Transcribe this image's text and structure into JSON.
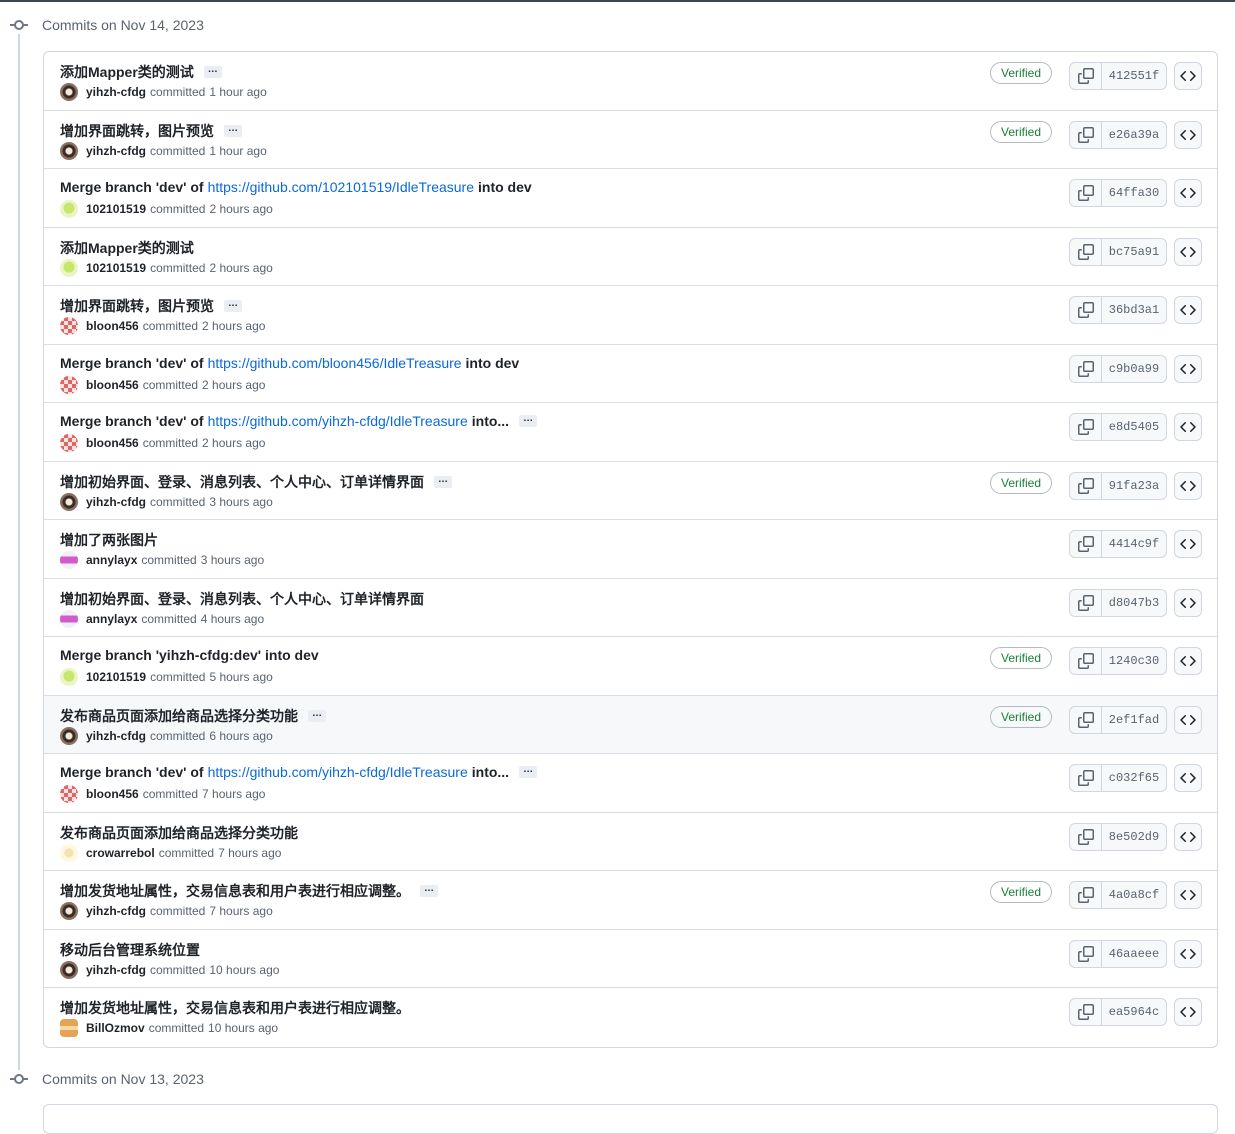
{
  "groups": [
    {
      "title": "Commits on Nov 14, 2023"
    },
    {
      "title": "Commits on Nov 13, 2023"
    }
  ],
  "committed_word": "committed",
  "verified_label": "Verified",
  "colors": {
    "verified_green": "#1a7f37",
    "link_blue": "#0969da",
    "muted": "#59636e"
  },
  "commits": [
    {
      "pre": "添加Mapper类的测试",
      "link": "",
      "post": "",
      "ellipsis": true,
      "author": "yihzh-cfdg",
      "avatar": "yihzh",
      "time": "1 hour ago",
      "verified": true,
      "sha": "412551f"
    },
    {
      "pre": "增加界面跳转，图片预览",
      "link": "",
      "post": "",
      "ellipsis": true,
      "author": "yihzh-cfdg",
      "avatar": "yihzh",
      "time": "1 hour ago",
      "verified": true,
      "sha": "e26a39a"
    },
    {
      "pre": "Merge branch 'dev' of",
      "link": "https://github.com/102101519/IdleTreasure",
      "post": "into dev",
      "ellipsis": false,
      "author": "102101519",
      "avatar": "green",
      "time": "2 hours ago",
      "verified": false,
      "sha": "64ffa30"
    },
    {
      "pre": "添加Mapper类的测试",
      "link": "",
      "post": "",
      "ellipsis": false,
      "author": "102101519",
      "avatar": "green",
      "time": "2 hours ago",
      "verified": false,
      "sha": "bc75a91"
    },
    {
      "pre": "增加界面跳转，图片预览",
      "link": "",
      "post": "",
      "ellipsis": true,
      "author": "bloon456",
      "avatar": "red",
      "time": "2 hours ago",
      "verified": false,
      "sha": "36bd3a1"
    },
    {
      "pre": "Merge branch 'dev' of",
      "link": "https://github.com/bloon456/IdleTreasure",
      "post": "into dev",
      "ellipsis": false,
      "author": "bloon456",
      "avatar": "red",
      "time": "2 hours ago",
      "verified": false,
      "sha": "c9b0a99"
    },
    {
      "pre": "Merge branch 'dev' of",
      "link": "https://github.com/yihzh-cfdg/IdleTreasure",
      "post": "into...",
      "ellipsis": true,
      "author": "bloon456",
      "avatar": "red",
      "time": "2 hours ago",
      "verified": false,
      "sha": "e8d5405"
    },
    {
      "pre": "增加初始界面、登录、消息列表、个人中心、订单详情界面",
      "link": "",
      "post": "",
      "ellipsis": true,
      "author": "yihzh-cfdg",
      "avatar": "yihzh",
      "time": "3 hours ago",
      "verified": true,
      "sha": "91fa23a"
    },
    {
      "pre": "增加了两张图片",
      "link": "",
      "post": "",
      "ellipsis": false,
      "author": "annylayx",
      "avatar": "pink",
      "time": "3 hours ago",
      "verified": false,
      "sha": "4414c9f"
    },
    {
      "pre": "增加初始界面、登录、消息列表、个人中心、订单详情界面",
      "link": "",
      "post": "",
      "ellipsis": false,
      "author": "annylayx",
      "avatar": "pink",
      "time": "4 hours ago",
      "verified": false,
      "sha": "d8047b3"
    },
    {
      "pre": "Merge branch 'yihzh-cfdg:dev' into dev",
      "link": "",
      "post": "",
      "ellipsis": false,
      "author": "102101519",
      "avatar": "green",
      "time": "5 hours ago",
      "verified": true,
      "sha": "1240c30"
    },
    {
      "pre": "发布商品页面添加给商品选择分类功能",
      "link": "",
      "post": "",
      "ellipsis": true,
      "author": "yihzh-cfdg",
      "avatar": "yihzh",
      "time": "6 hours ago",
      "verified": true,
      "sha": "2ef1fad",
      "highlight": true
    },
    {
      "pre": "Merge branch 'dev' of",
      "link": "https://github.com/yihzh-cfdg/IdleTreasure",
      "post": "into...",
      "ellipsis": true,
      "author": "bloon456",
      "avatar": "red",
      "time": "7 hours ago",
      "verified": false,
      "sha": "c032f65"
    },
    {
      "pre": "发布商品页面添加给商品选择分类功能",
      "link": "",
      "post": "",
      "ellipsis": false,
      "author": "crowarrebol",
      "avatar": "yellow",
      "time": "7 hours ago",
      "verified": false,
      "sha": "8e502d9"
    },
    {
      "pre": "增加发货地址属性，交易信息表和用户表进行相应调整。",
      "link": "",
      "post": "",
      "ellipsis": true,
      "author": "yihzh-cfdg",
      "avatar": "yihzh",
      "time": "7 hours ago",
      "verified": true,
      "sha": "4a0a8cf"
    },
    {
      "pre": "移动后台管理系统位置",
      "link": "",
      "post": "",
      "ellipsis": false,
      "author": "yihzh-cfdg",
      "avatar": "yihzh",
      "time": "10 hours ago",
      "verified": false,
      "sha": "46aaeee"
    },
    {
      "pre": "增加发货地址属性，交易信息表和用户表进行相应调整。",
      "link": "",
      "post": "",
      "ellipsis": false,
      "author": "BillOzmov",
      "avatar": "orange",
      "time": "10 hours ago",
      "verified": false,
      "sha": "ea5964c"
    }
  ]
}
